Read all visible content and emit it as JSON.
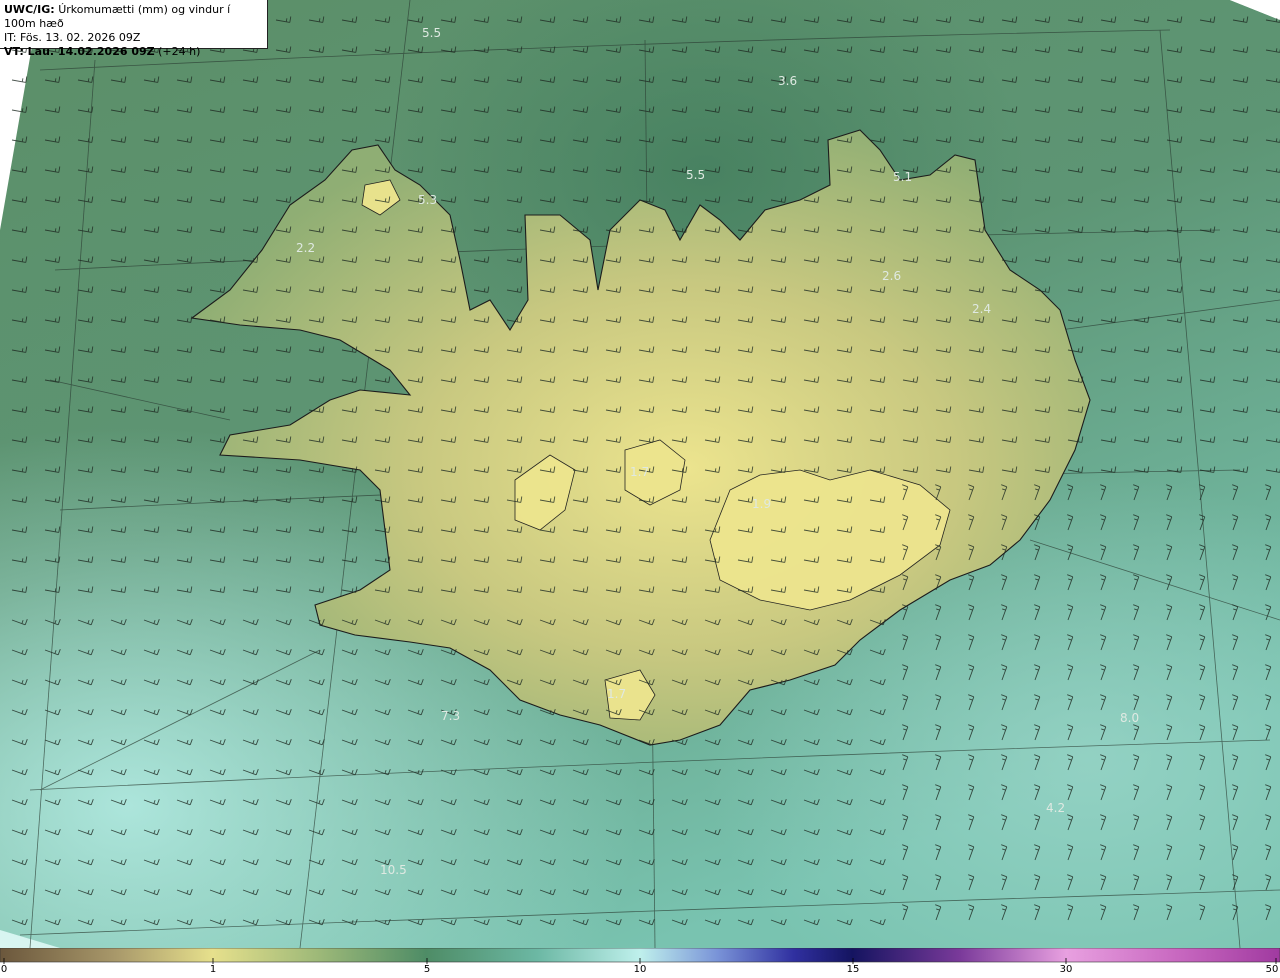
{
  "header": {
    "model": "UWC/IG:",
    "title": "Úrkomumætti (mm) og vindur í 100m hæð",
    "issue_time": "IT: Fös. 13. 02. 2026 09Z",
    "valid_prefix": "VT: Lau. 14.02.2026 09Z",
    "valid_suffix": "(+24 h)"
  },
  "colorbar": {
    "tick_labels": [
      {
        "value": 0,
        "label": "0"
      },
      {
        "value": 1,
        "label": "1"
      },
      {
        "value": 5,
        "label": "5"
      },
      {
        "value": 10,
        "label": "10"
      },
      {
        "value": 15,
        "label": "15"
      },
      {
        "value": 30,
        "label": "30"
      },
      {
        "value": 50,
        "label": "50"
      }
    ],
    "colors": [
      "#6e5a3e",
      "#a89a6a",
      "#e6e08a",
      "#5f9e78",
      "#a8e8e0",
      "#3a3aa0",
      "#1a1a6e",
      "#c878c8",
      "#e8a8e8"
    ]
  },
  "value_labels": [
    {
      "text": "5.5"
    },
    {
      "text": "3.6"
    },
    {
      "text": "5.5"
    },
    {
      "text": "5.1"
    },
    {
      "text": "5.3"
    },
    {
      "text": "2.2"
    },
    {
      "text": "2.6"
    },
    {
      "text": "2.4"
    },
    {
      "text": "1.7"
    },
    {
      "text": "1.9"
    },
    {
      "text": "1.7"
    },
    {
      "text": "7.3"
    },
    {
      "text": "8.0"
    },
    {
      "text": "4.2"
    },
    {
      "text": "10.5"
    }
  ]
}
